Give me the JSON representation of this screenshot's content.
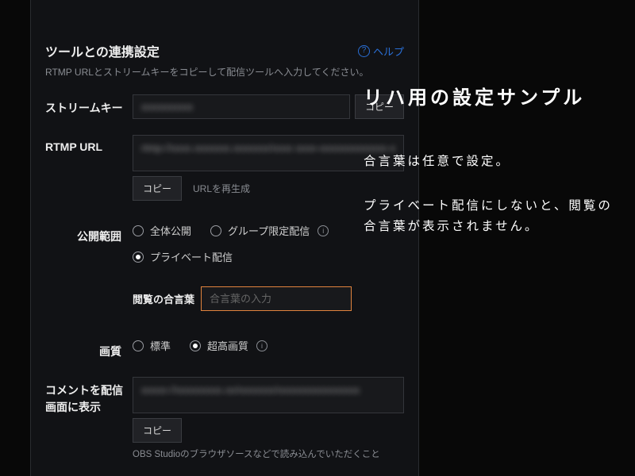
{
  "section": {
    "title": "ツールとの連携設定",
    "help": "ヘルプ",
    "desc": "RTMP URLとストリームキーをコピーして配信ツールへ入力してください。"
  },
  "copy_label": "コピー",
  "regen_label": "URLを再生成",
  "stream_key": {
    "label": "ストリームキー",
    "value": "xxxxxxxxxx"
  },
  "rtmp_url": {
    "label": "RTMP URL",
    "value": "rtmp://xxxx.xxxxxxx.xxxxxxx/xxxx xxxx-xxxxxxxxxxxxx-x"
  },
  "visibility": {
    "label": "公開範囲",
    "options": {
      "public": "全体公開",
      "group": "グループ限定配信",
      "private": "プライベート配信"
    },
    "selected": "private",
    "password": {
      "label": "閲覧の合言葉",
      "placeholder": "合言葉の入力"
    }
  },
  "quality": {
    "label": "画質",
    "options": {
      "standard": "標準",
      "ultra": "超高画質"
    },
    "selected": "ultra"
  },
  "comment_overlay": {
    "label": "コメントを配信画面に表示",
    "value": "xxxxx://xxxxxxxxx.xx/xxxxxxx/xxxxxxxxxxxxxxxx",
    "footnote": "OBS Studioのブラウザソースなどで読み込んでいただくこと"
  },
  "annotation": {
    "title": "リハ用の設定サンプル",
    "line1": "合言葉は任意で設定。",
    "line2": "プライベート配信にしないと、閲覧の合言葉が表示されません。"
  }
}
